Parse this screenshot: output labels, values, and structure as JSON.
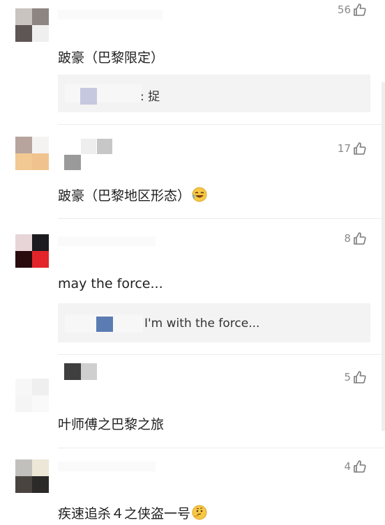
{
  "comments": [
    {
      "likes": "56",
      "text": "跛豪（巴黎限定）",
      "reply": ": 捉"
    },
    {
      "likes": "17",
      "text": "跛豪（巴黎地区形态）"
    },
    {
      "likes": "8",
      "text": "may the force...",
      "reply": "I'm with the force..."
    },
    {
      "likes": "5",
      "text": "叶师傅之巴黎之旅"
    },
    {
      "likes": "4",
      "text": "疾速追杀４之侠盗一号"
    }
  ],
  "icons": {
    "like": "thumbs-up-icon",
    "emoji_laugh": "laughing-crying-emoji-icon",
    "emoji_think": "thinking-emoji-icon"
  },
  "colors": {
    "background": "#ffffff",
    "reply_bg": "#f3f3f3",
    "muted": "#8a8a8a"
  }
}
